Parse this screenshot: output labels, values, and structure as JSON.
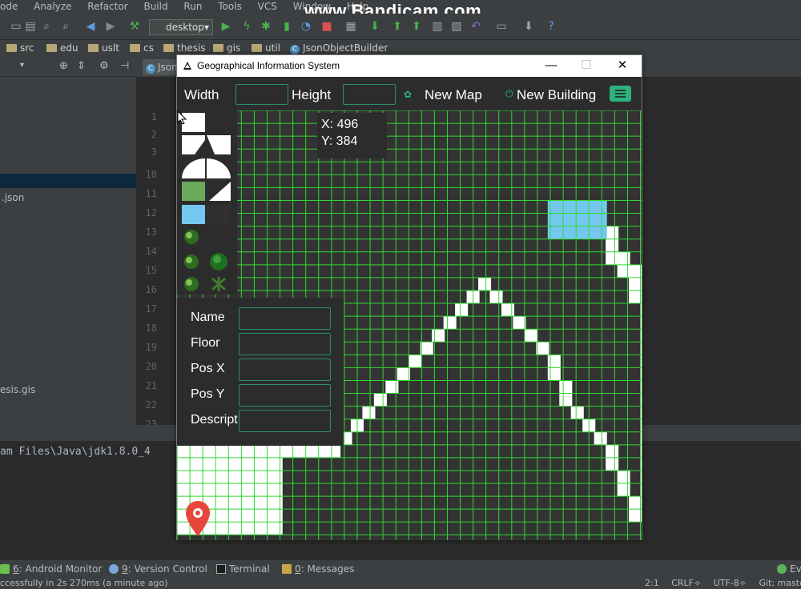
{
  "ide": {
    "menus": [
      "ode",
      "Analyze",
      "Refactor",
      "Build",
      "Run",
      "Tools",
      "VCS",
      "Window",
      "Help"
    ],
    "watermark": "www.Bandicam.com",
    "run_config": "desktop",
    "breadcrumbs": [
      "src",
      "edu",
      "uslt",
      "cs",
      "thesis",
      "gis",
      "util",
      "JsonObjectBuilder"
    ],
    "editor_tab": "Json",
    "project_files": {
      "json": ".json",
      "gis": "esis.gis"
    },
    "line_numbers": [
      "1",
      "2",
      "3",
      "10",
      "11",
      "12",
      "13",
      "14",
      "15",
      "16",
      "17",
      "18",
      "19",
      "20",
      "21",
      "22",
      "23"
    ],
    "console_text": "am Files\\Java\\jdk1.8.0_4",
    "bottom_tabs": [
      {
        "prefix": "6",
        "label": ": Android Monitor"
      },
      {
        "prefix": "9",
        "label": ": Version Control"
      },
      {
        "prefix": "",
        "label": "Terminal"
      },
      {
        "prefix": "0",
        "label": ": Messages"
      }
    ],
    "event_log": "Ev",
    "status_message": "ccessfully in 2s 270ms (a minute ago)",
    "status_right": {
      "position": "2:1",
      "line_sep": "CRLF÷",
      "encoding": "UTF-8÷",
      "git": "Git: master÷"
    }
  },
  "app": {
    "title": "Geographical Information System",
    "window_controls": {
      "minimize": "—",
      "maximize": "☐",
      "close": "✕"
    },
    "toolbar": {
      "width_label": "Width",
      "height_label": "Height",
      "width_value": "",
      "height_value": "",
      "new_map_label": "New Map",
      "new_building_label": "New Building"
    },
    "coords": {
      "x_text": "X: 496",
      "y_text": "Y: 384"
    },
    "form": {
      "fields": [
        {
          "label": "Name",
          "value": ""
        },
        {
          "label": "Floor",
          "value": ""
        },
        {
          "label": "Pos X",
          "value": ""
        },
        {
          "label": "Pos Y",
          "value": ""
        },
        {
          "label": "Descript",
          "value": ""
        }
      ]
    },
    "colors": {
      "grid_line": "#33d733",
      "grid_bg": "#333333",
      "road": "#ffffff",
      "building": "#74c8f0",
      "grass": "#6aaa5a",
      "accent": "#2eb17c",
      "marker": "#e8463a"
    },
    "map": {
      "cols": 36,
      "rows": 33,
      "road_cells": [
        [
          0,
          26
        ],
        [
          1,
          26
        ],
        [
          2,
          26
        ],
        [
          3,
          26
        ],
        [
          4,
          26
        ],
        [
          5,
          26
        ],
        [
          6,
          26
        ],
        [
          7,
          26
        ],
        [
          8,
          26
        ],
        [
          9,
          26
        ],
        [
          10,
          26
        ],
        [
          11,
          26
        ],
        [
          12,
          26
        ],
        [
          13,
          26
        ],
        [
          0,
          27
        ],
        [
          1,
          27
        ],
        [
          2,
          27
        ],
        [
          3,
          27
        ],
        [
          4,
          27
        ],
        [
          5,
          27
        ],
        [
          6,
          27
        ],
        [
          7,
          27
        ],
        [
          8,
          27
        ],
        [
          0,
          28
        ],
        [
          1,
          28
        ],
        [
          2,
          28
        ],
        [
          3,
          28
        ],
        [
          4,
          28
        ],
        [
          5,
          28
        ],
        [
          6,
          28
        ],
        [
          7,
          28
        ],
        [
          8,
          28
        ],
        [
          0,
          29
        ],
        [
          1,
          29
        ],
        [
          2,
          29
        ],
        [
          3,
          29
        ],
        [
          4,
          29
        ],
        [
          5,
          29
        ],
        [
          6,
          29
        ],
        [
          7,
          29
        ],
        [
          8,
          29
        ],
        [
          0,
          30
        ],
        [
          1,
          30
        ],
        [
          2,
          30
        ],
        [
          3,
          30
        ],
        [
          4,
          30
        ],
        [
          5,
          30
        ],
        [
          6,
          30
        ],
        [
          7,
          30
        ],
        [
          8,
          30
        ],
        [
          0,
          31
        ],
        [
          1,
          31
        ],
        [
          2,
          31
        ],
        [
          3,
          31
        ],
        [
          4,
          31
        ],
        [
          5,
          31
        ],
        [
          6,
          31
        ],
        [
          7,
          31
        ],
        [
          8,
          31
        ],
        [
          0,
          32
        ],
        [
          1,
          32
        ],
        [
          2,
          32
        ],
        [
          3,
          32
        ],
        [
          4,
          32
        ],
        [
          5,
          32
        ],
        [
          6,
          32
        ],
        [
          7,
          32
        ],
        [
          8,
          32
        ],
        [
          14,
          25
        ],
        [
          15,
          24
        ],
        [
          16,
          23
        ],
        [
          17,
          22
        ],
        [
          18,
          21
        ],
        [
          19,
          20
        ],
        [
          20,
          19
        ],
        [
          21,
          18
        ],
        [
          22,
          17
        ],
        [
          23,
          16
        ],
        [
          24,
          15
        ],
        [
          25,
          14
        ],
        [
          26,
          13
        ],
        [
          27,
          14
        ],
        [
          28,
          15
        ],
        [
          29,
          16
        ],
        [
          30,
          17
        ],
        [
          31,
          18
        ],
        [
          32,
          19
        ],
        [
          32,
          20
        ],
        [
          33,
          21
        ],
        [
          33,
          22
        ],
        [
          34,
          23
        ],
        [
          35,
          24
        ],
        [
          36,
          25
        ],
        [
          37,
          26
        ],
        [
          37,
          27
        ],
        [
          38,
          28
        ],
        [
          38,
          29
        ],
        [
          39,
          30
        ],
        [
          39,
          31
        ],
        [
          40,
          31
        ],
        [
          40,
          30
        ],
        [
          40,
          29
        ],
        [
          40,
          28
        ],
        [
          40,
          27
        ],
        [
          40,
          26
        ],
        [
          40,
          25
        ],
        [
          40,
          24
        ],
        [
          40,
          23
        ],
        [
          40,
          22
        ],
        [
          40,
          21
        ],
        [
          40,
          20
        ],
        [
          40,
          19
        ],
        [
          40,
          18
        ],
        [
          40,
          17
        ],
        [
          40,
          16
        ],
        [
          40,
          15
        ],
        [
          40,
          14
        ],
        [
          39,
          14
        ],
        [
          39,
          13
        ],
        [
          39,
          12
        ],
        [
          38,
          12
        ],
        [
          38,
          11
        ],
        [
          37,
          11
        ],
        [
          37,
          10
        ],
        [
          37,
          9
        ]
      ],
      "building_cells": [
        [
          32,
          7
        ],
        [
          33,
          7
        ],
        [
          34,
          7
        ],
        [
          35,
          7
        ],
        [
          36,
          7
        ],
        [
          32,
          8
        ],
        [
          33,
          8
        ],
        [
          34,
          8
        ],
        [
          35,
          8
        ],
        [
          36,
          8
        ],
        [
          32,
          9
        ],
        [
          33,
          9
        ],
        [
          34,
          9
        ],
        [
          35,
          9
        ],
        [
          36,
          9
        ]
      ]
    },
    "palette_items": [
      {
        "name": "road-tile-swatch"
      },
      {
        "name": "road-corner-swatch"
      },
      {
        "name": "round-corner-swatch"
      },
      {
        "name": "grass-swatch"
      },
      {
        "name": "building-swatch"
      },
      {
        "name": "tree-swatch"
      }
    ]
  }
}
